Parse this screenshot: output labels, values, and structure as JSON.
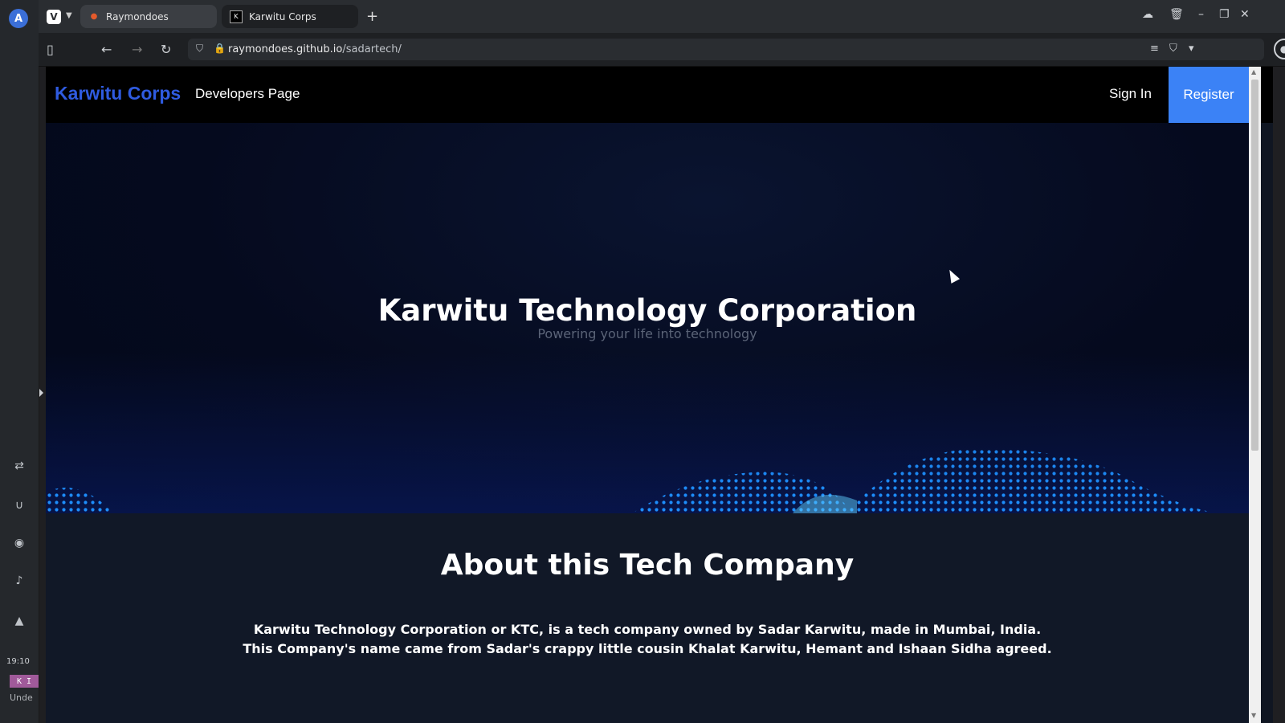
{
  "browser": {
    "tabs": [
      {
        "label": "Raymondoes",
        "icon": "flame-icon"
      },
      {
        "label": "Karwitu Corps",
        "icon": "site-favicon"
      }
    ],
    "url_host": "raymondoes.github.io",
    "url_path": "/sadartech/"
  },
  "side_panel": {
    "time": "19:10",
    "tag": "K I",
    "tag2": "Unde"
  },
  "navbar": {
    "brand": "Karwitu Corps",
    "developers_link": "Developers Page",
    "sign_in": "Sign In",
    "register": "Register"
  },
  "hero": {
    "title": "Karwitu Technology Corporation",
    "subtitle": "Powering your life into technology"
  },
  "about": {
    "title": "About this Tech Company",
    "line1": "Karwitu Technology Corporation or KTC, is a tech company owned by Sadar Karwitu, made in Mumbai, India.",
    "line2": "This Company's name came from Sadar's crappy little cousin Khalat Karwitu, Hemant and Ishaan Sidha agreed."
  },
  "colors": {
    "brand": "#2f5be0",
    "register_bg": "#3b82f6",
    "hero_bg": "#050a1e",
    "dots": "#1e90ff"
  }
}
